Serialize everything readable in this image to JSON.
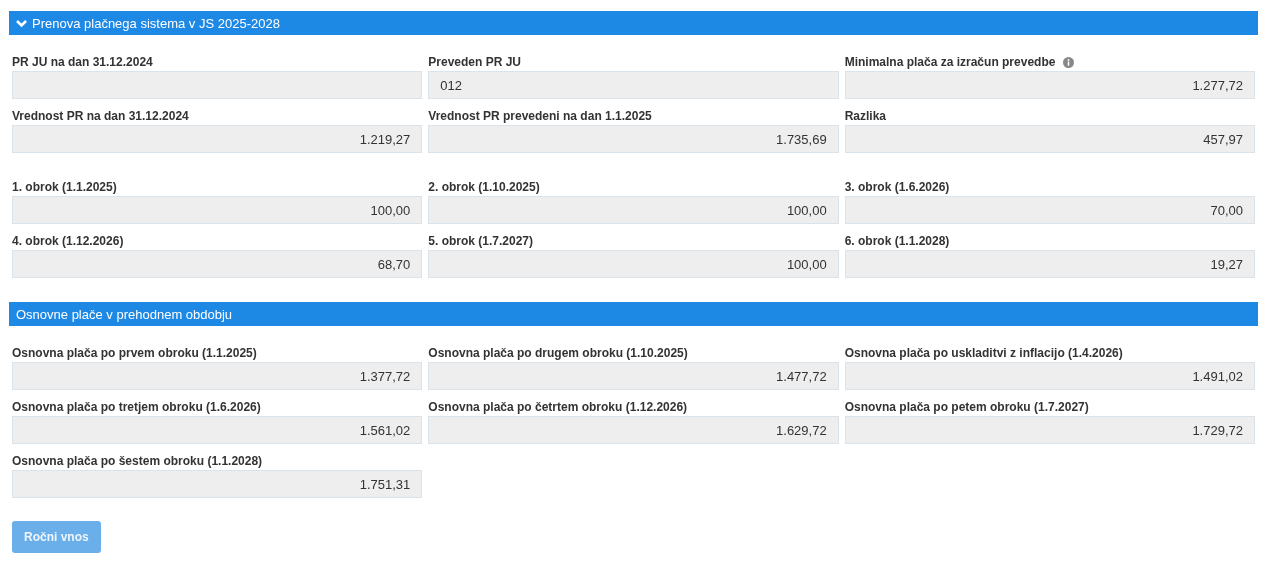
{
  "sections": [
    {
      "title": "Prenova plačnega sistema v JS 2025-2028",
      "expanded": true,
      "groups": [
        [
          {
            "label": "PR JU na dan 31.12.2024",
            "kind": "number"
          },
          {
            "label": "Preveden PR JU",
            "value": "012",
            "kind": "text"
          },
          {
            "label": "Minimalna plača za izračun prevedbe",
            "info": true,
            "value": "1.277,72",
            "kind": "number"
          },
          {
            "label": "Vrednost PR na dan 31.12.2024",
            "value": "1.219,27",
            "kind": "number"
          },
          {
            "label": "Vrednost PR prevedeni na dan 1.1.2025",
            "value": "1.735,69",
            "kind": "number"
          },
          {
            "label": "Razlika",
            "value": "457,97",
            "kind": "number"
          }
        ],
        [
          {
            "label": "1. obrok (1.1.2025)",
            "value": "100,00",
            "kind": "number"
          },
          {
            "label": "2. obrok (1.10.2025)",
            "value": "100,00",
            "kind": "number"
          },
          {
            "label": "3. obrok (1.6.2026)",
            "value": "70,00",
            "kind": "number"
          },
          {
            "label": "4. obrok (1.12.2026)",
            "value": "68,70",
            "kind": "number"
          },
          {
            "label": "5. obrok (1.7.2027)",
            "value": "100,00",
            "kind": "number"
          },
          {
            "label": "6. obrok (1.1.2028)",
            "value": "19,27",
            "kind": "number"
          }
        ]
      ]
    },
    {
      "title": "Osnovne plače v prehodnem obdobju",
      "groups": [
        [
          {
            "label": "Osnovna plača po prvem obroku (1.1.2025)",
            "value": "1.377,72",
            "kind": "number"
          },
          {
            "label": "Osnovna plača po drugem obroku (1.10.2025)",
            "value": "1.477,72",
            "kind": "number"
          },
          {
            "label": "Osnovna plača po uskladitvi z inflacijo (1.4.2026)",
            "value": "1.491,02",
            "kind": "number"
          },
          {
            "label": "Osnovna plača po tretjem obroku (1.6.2026)",
            "value": "1.561,02",
            "kind": "number"
          },
          {
            "label": "Osnovna plača po četrtem obroku (1.12.2026)",
            "value": "1.629,72",
            "kind": "number"
          },
          {
            "label": "Osnovna plača po petem obroku (1.7.2027)",
            "value": "1.729,72",
            "kind": "number"
          },
          {
            "label": "Osnovna plača po šestem obroku (1.1.2028)",
            "value": "1.751,31",
            "kind": "number"
          }
        ]
      ]
    }
  ],
  "button": {
    "label": "Ročni vnos",
    "disabled": true
  }
}
